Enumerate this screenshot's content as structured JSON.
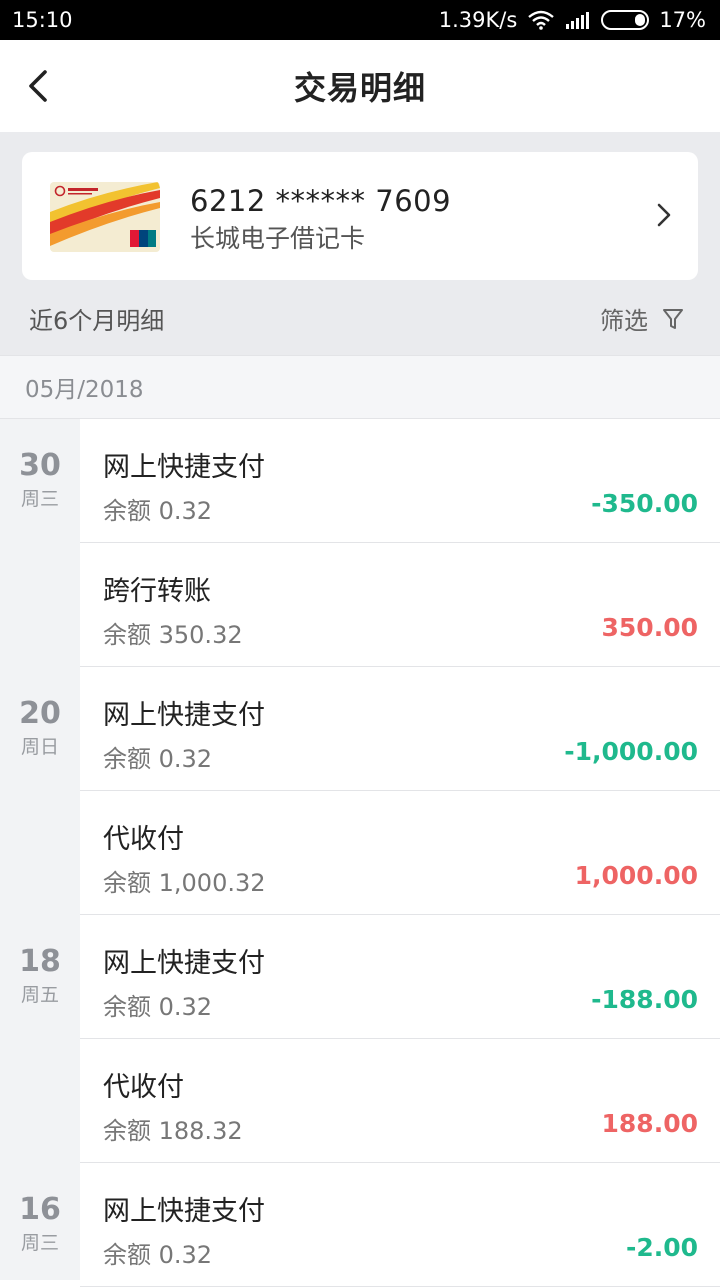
{
  "status_bar": {
    "time": "15:10",
    "network_speed": "1.39K/s",
    "battery": "17%",
    "icons": [
      "wifi-icon",
      "signal-icon",
      "battery-icon"
    ]
  },
  "header": {
    "title": "交易明细",
    "back_icon": "chevron-left-icon"
  },
  "card": {
    "number": "6212 ****** 7609",
    "name": "长城电子借记卡",
    "chevron_icon": "chevron-right-icon"
  },
  "period": {
    "label": "近6个月明细",
    "filter_label": "筛选",
    "filter_icon": "filter-icon"
  },
  "month_header": "05月/2018",
  "dates": [
    {
      "day": "30",
      "weekday": "周三"
    },
    {
      "day": "20",
      "weekday": "周日"
    },
    {
      "day": "18",
      "weekday": "周五"
    },
    {
      "day": "16",
      "weekday": "周三"
    }
  ],
  "transactions": [
    {
      "title": "网上快捷支付",
      "balance": "余额 0.32",
      "amount": "-350.00",
      "type": "debit"
    },
    {
      "title": "跨行转账",
      "balance": "余额 350.32",
      "amount": "350.00",
      "type": "credit"
    },
    {
      "title": "网上快捷支付",
      "balance": "余额 0.32",
      "amount": "-1,000.00",
      "type": "debit"
    },
    {
      "title": "代收付",
      "balance": "余额 1,000.32",
      "amount": "1,000.00",
      "type": "credit"
    },
    {
      "title": "网上快捷支付",
      "balance": "余额 0.32",
      "amount": "-188.00",
      "type": "debit"
    },
    {
      "title": "代收付",
      "balance": "余额 188.32",
      "amount": "188.00",
      "type": "credit"
    },
    {
      "title": "网上快捷支付",
      "balance": "余额 0.32",
      "amount": "-2.00",
      "type": "debit"
    }
  ],
  "colors": {
    "debit": "#1fb98d",
    "credit": "#ee6464"
  }
}
